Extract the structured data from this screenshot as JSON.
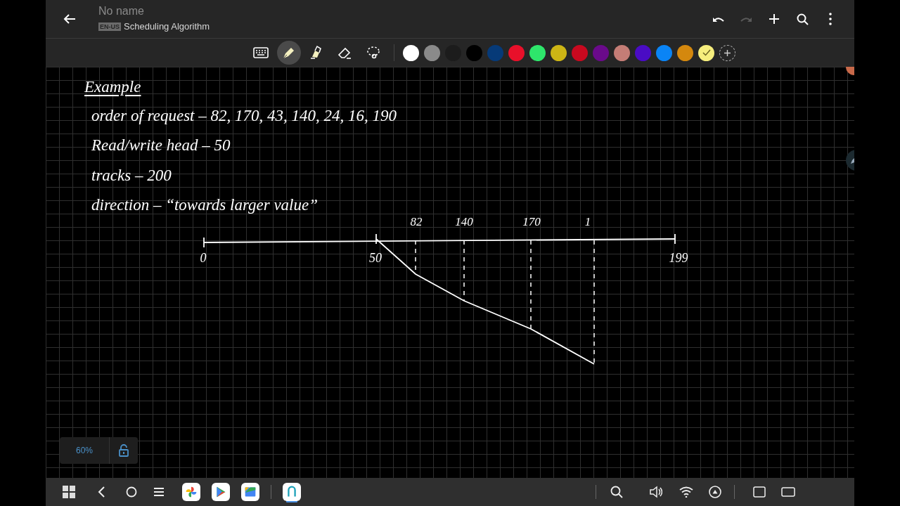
{
  "app_bar": {
    "title": "No name",
    "language": "EN-US",
    "subtitle": "Scheduling Algorithm",
    "actions": [
      {
        "kind": "undo",
        "disabled": false
      },
      {
        "kind": "redo",
        "disabled": true
      },
      {
        "kind": "add",
        "disabled": false
      },
      {
        "kind": "search",
        "disabled": false
      },
      {
        "kind": "more",
        "disabled": false
      }
    ]
  },
  "toolbar": {
    "tools": [
      {
        "kind": "keyboard",
        "selected": false
      },
      {
        "kind": "pen",
        "selected": true
      },
      {
        "kind": "highlighter",
        "selected": false
      },
      {
        "kind": "eraser",
        "selected": false
      },
      {
        "kind": "lasso",
        "selected": false
      }
    ],
    "colors": [
      {
        "color": "#ffffff",
        "selected": false
      },
      {
        "color": "#8a8a8a",
        "selected": false
      },
      {
        "color": "#1c1c1c",
        "selected": false
      },
      {
        "color": "#000000",
        "selected": false
      },
      {
        "color": "#063a78",
        "selected": false
      },
      {
        "color": "#e8102a",
        "selected": false
      },
      {
        "color": "#2ee66b",
        "selected": false
      },
      {
        "color": "#cdb515",
        "selected": false
      },
      {
        "color": "#c8091f",
        "selected": false
      },
      {
        "color": "#6a0a8a",
        "selected": false
      },
      {
        "color": "#c47d76",
        "selected": false
      },
      {
        "color": "#4a0cc4",
        "selected": false
      },
      {
        "color": "#0a84f5",
        "selected": false
      },
      {
        "color": "#d4880e",
        "selected": false
      },
      {
        "color": "#f6ee7d",
        "selected": true
      }
    ]
  },
  "note": {
    "heading": "Example",
    "lines": [
      "order of request – 82, 170, 43, 140, 24, 16, 190",
      "Read/write head – 50",
      "tracks – 200",
      "direction – “towards larger value”"
    ],
    "diagram": {
      "labels_above": [
        "82",
        "140",
        "170",
        "1"
      ],
      "labels_below": [
        "0",
        "50",
        "199"
      ]
    }
  },
  "zoom": {
    "reading": "60%",
    "locked": false
  },
  "taskbar": {
    "apps": [
      {
        "kind": "photos",
        "active": false
      },
      {
        "kind": "store",
        "active": false
      },
      {
        "kind": "files",
        "active": false
      },
      {
        "kind": "notes",
        "active": true
      }
    ]
  }
}
